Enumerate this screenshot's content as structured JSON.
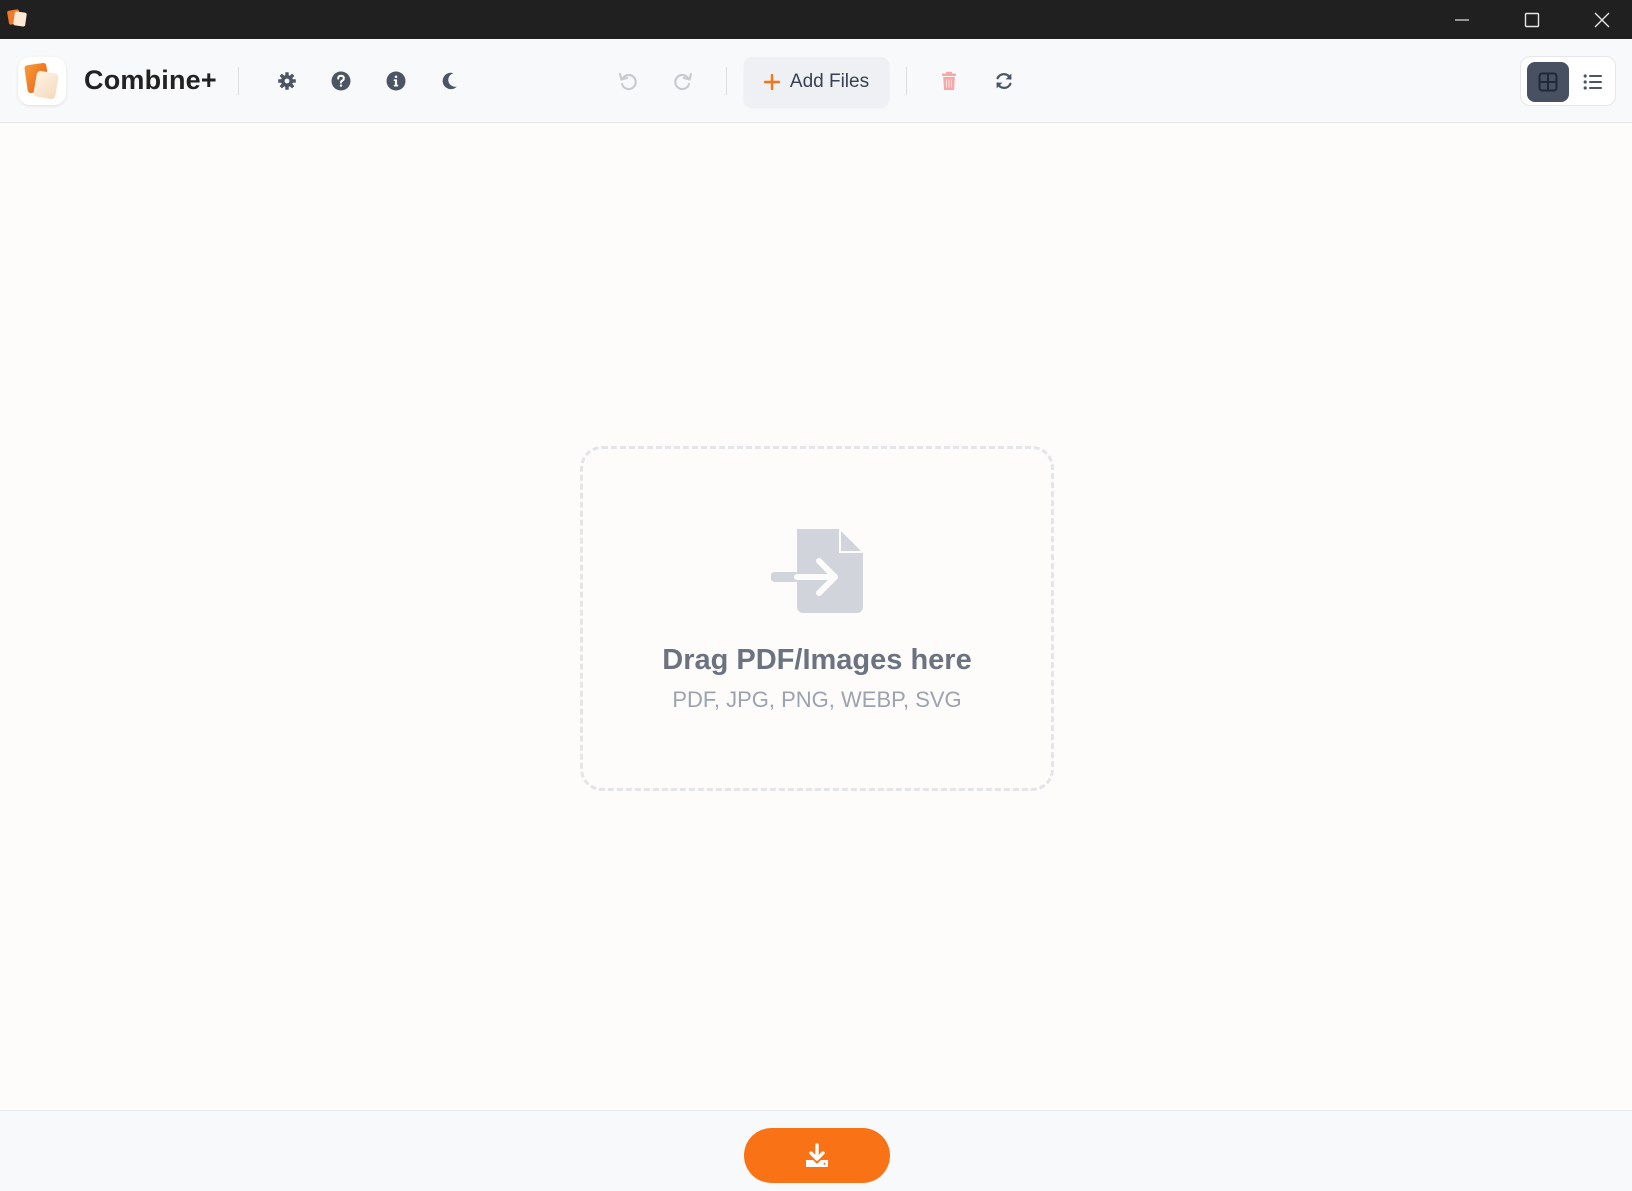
{
  "app": {
    "title": "Combine+"
  },
  "toolbar": {
    "buttons": [
      {
        "name": "settings",
        "icon": "gear-icon"
      },
      {
        "name": "help",
        "icon": "question-circle-icon"
      },
      {
        "name": "about",
        "icon": "info-circle-icon"
      },
      {
        "name": "theme",
        "icon": "moon-icon"
      },
      {
        "name": "undo",
        "icon": "undo-icon"
      },
      {
        "name": "redo",
        "icon": "redo-icon"
      },
      {
        "name": "delete",
        "icon": "trash-icon"
      },
      {
        "name": "refresh",
        "icon": "refresh-icon"
      }
    ],
    "add_files_label": "Add Files"
  },
  "view_toggle": {
    "selected": "grid",
    "options": [
      "grid",
      "list"
    ]
  },
  "dropzone": {
    "title": "Drag PDF/Images here",
    "formats": "PDF, JPG, PNG, WEBP, SVG"
  },
  "footer": {
    "download_icon": "download-icon"
  },
  "colors": {
    "accent": "#f97316",
    "titlebar": "#202020",
    "toolbar_bg": "#f8f9fa",
    "content_bg": "#fdfcfa",
    "view_selected": "#475161",
    "delete_disabled": "#fca5a5"
  }
}
